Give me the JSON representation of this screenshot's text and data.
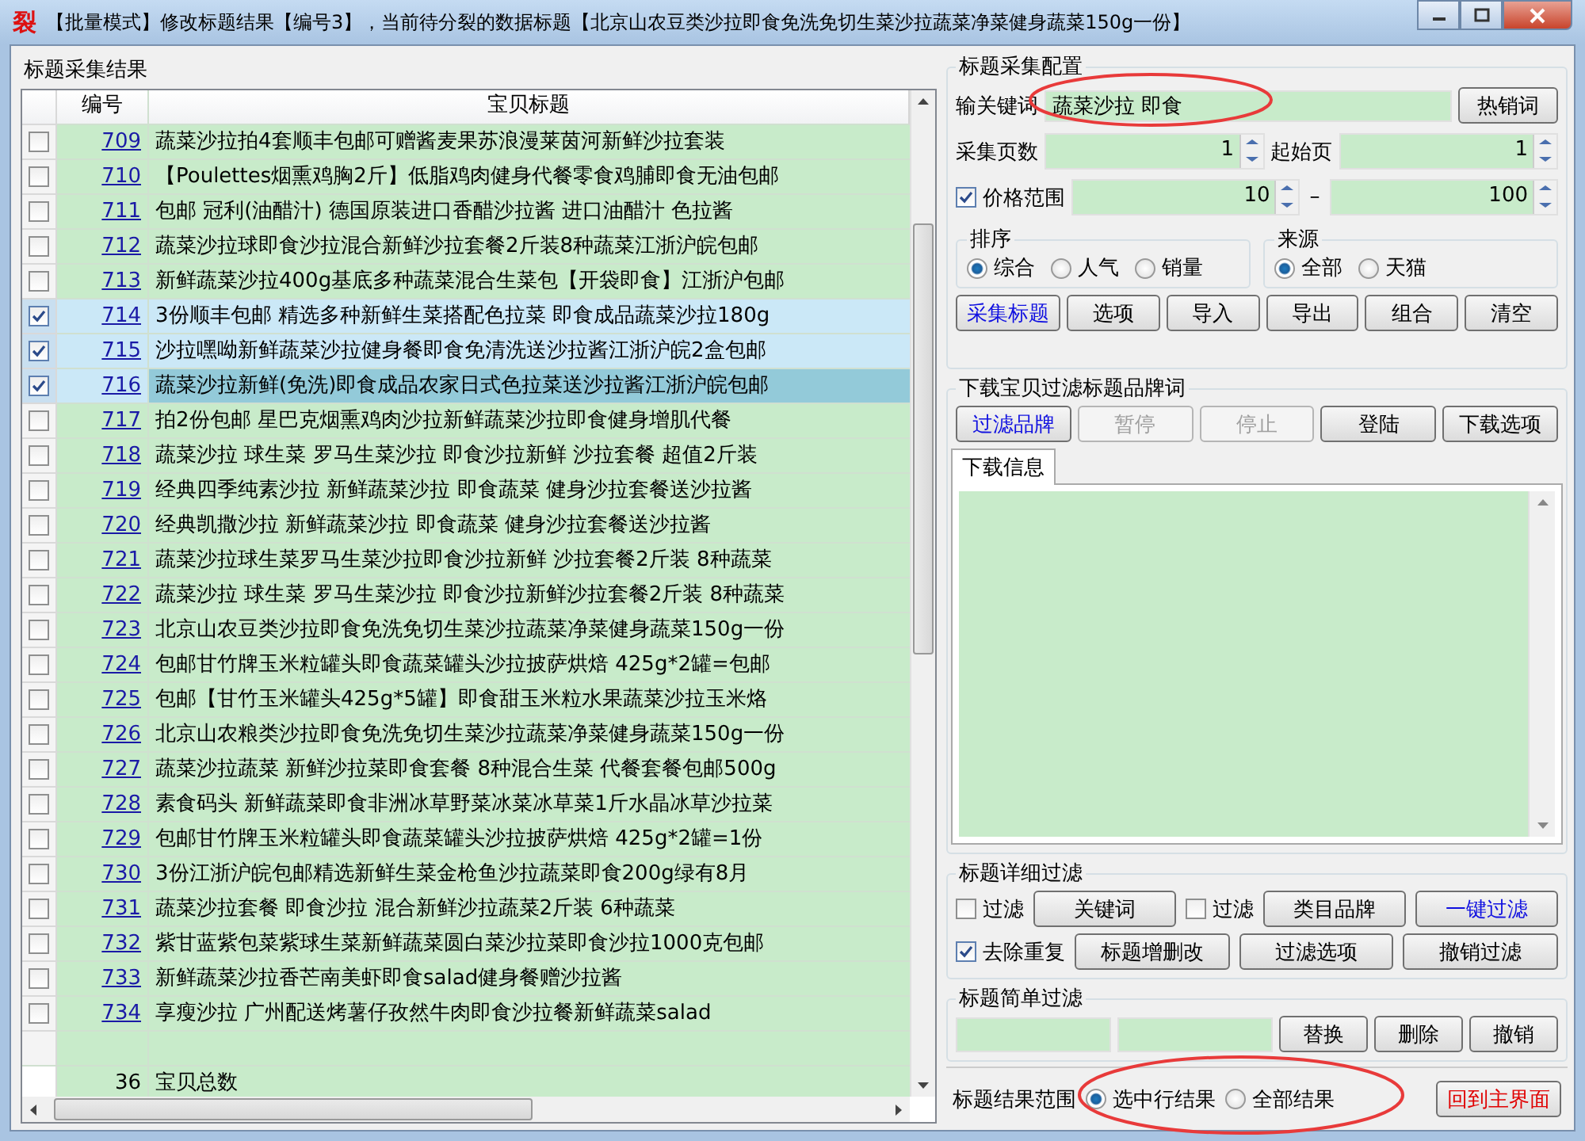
{
  "window": {
    "icon_text": "裂",
    "title": "【批量模式】修改标题结果【编号3】，当前待分裂的数据标题【北京山农豆类沙拉即食免洗免切生菜沙拉蔬菜净菜健身蔬菜150g一份】"
  },
  "results": {
    "title": "标题采集结果",
    "columns": [
      "编号",
      "宝贝标题"
    ],
    "rows": [
      {
        "number": "709",
        "title": "蔬菜沙拉拍4套顺丰包邮可赠酱麦果苏浪漫莱茵河新鲜沙拉套装",
        "checked": false,
        "selected": false
      },
      {
        "number": "710",
        "title": "【Poulettes烟熏鸡胸2斤】低脂鸡肉健身代餐零食鸡脯即食无油包邮",
        "checked": false,
        "selected": false
      },
      {
        "number": "711",
        "title": "包邮 冠利(油醋汁) 德国原装进口香醋沙拉酱 进口油醋汁 色拉酱",
        "checked": false,
        "selected": false
      },
      {
        "number": "712",
        "title": "蔬菜沙拉球即食沙拉混合新鲜沙拉套餐2斤装8种蔬菜江浙沪皖包邮",
        "checked": false,
        "selected": false
      },
      {
        "number": "713",
        "title": "新鲜蔬菜沙拉400g基底多种蔬菜混合生菜包【开袋即食】江浙沪包邮",
        "checked": false,
        "selected": false
      },
      {
        "number": "714",
        "title": "3份顺丰包邮 精选多种新鲜生菜搭配色拉菜 即食成品蔬菜沙拉180g",
        "checked": true,
        "selected": false
      },
      {
        "number": "715",
        "title": "沙拉嘿呦新鲜蔬菜沙拉健身餐即食免清洗送沙拉酱江浙沪皖2盒包邮",
        "checked": true,
        "selected": false
      },
      {
        "number": "716",
        "title": "蔬菜沙拉新鲜(免洗)即食成品农家日式色拉菜送沙拉酱江浙沪皖包邮",
        "checked": true,
        "selected": true
      },
      {
        "number": "717",
        "title": "拍2份包邮 星巴克烟熏鸡肉沙拉新鲜蔬菜沙拉即食健身增肌代餐",
        "checked": false,
        "selected": false
      },
      {
        "number": "718",
        "title": "蔬菜沙拉 球生菜 罗马生菜沙拉 即食沙拉新鲜 沙拉套餐 超值2斤装",
        "checked": false,
        "selected": false
      },
      {
        "number": "719",
        "title": "经典四季纯素沙拉 新鲜蔬菜沙拉 即食蔬菜 健身沙拉套餐送沙拉酱",
        "checked": false,
        "selected": false
      },
      {
        "number": "720",
        "title": "经典凯撒沙拉 新鲜蔬菜沙拉 即食蔬菜 健身沙拉套餐送沙拉酱",
        "checked": false,
        "selected": false
      },
      {
        "number": "721",
        "title": "蔬菜沙拉球生菜罗马生菜沙拉即食沙拉新鲜 沙拉套餐2斤装 8种蔬菜",
        "checked": false,
        "selected": false
      },
      {
        "number": "722",
        "title": "蔬菜沙拉 球生菜 罗马生菜沙拉 即食沙拉新鲜沙拉套餐2斤装 8种蔬菜",
        "checked": false,
        "selected": false
      },
      {
        "number": "723",
        "title": "北京山农豆类沙拉即食免洗免切生菜沙拉蔬菜净菜健身蔬菜150g一份",
        "checked": false,
        "selected": false
      },
      {
        "number": "724",
        "title": "包邮甘竹牌玉米粒罐头即食蔬菜罐头沙拉披萨烘焙 425g*2罐=包邮",
        "checked": false,
        "selected": false
      },
      {
        "number": "725",
        "title": "包邮【甘竹玉米罐头425g*5罐】即食甜玉米粒水果蔬菜沙拉玉米烙",
        "checked": false,
        "selected": false
      },
      {
        "number": "726",
        "title": "北京山农粮类沙拉即食免洗免切生菜沙拉蔬菜净菜健身蔬菜150g一份",
        "checked": false,
        "selected": false
      },
      {
        "number": "727",
        "title": "蔬菜沙拉蔬菜 新鲜沙拉菜即食套餐 8种混合生菜 代餐套餐包邮500g",
        "checked": false,
        "selected": false
      },
      {
        "number": "728",
        "title": "素食码头 新鲜蔬菜即食非洲冰草野菜冰菜冰草菜1斤水晶冰草沙拉菜",
        "checked": false,
        "selected": false
      },
      {
        "number": "729",
        "title": "包邮甘竹牌玉米粒罐头即食蔬菜罐头沙拉披萨烘焙 425g*2罐=1份",
        "checked": false,
        "selected": false
      },
      {
        "number": "730",
        "title": "3份江浙沪皖包邮精选新鲜生菜金枪鱼沙拉蔬菜即食200g绿有8月",
        "checked": false,
        "selected": false
      },
      {
        "number": "731",
        "title": "蔬菜沙拉套餐 即食沙拉 混合新鲜沙拉蔬菜2斤装 6种蔬菜",
        "checked": false,
        "selected": false
      },
      {
        "number": "732",
        "title": "紫甘蓝紫包菜紫球生菜新鲜蔬菜圆白菜沙拉菜即食沙拉1000克包邮",
        "checked": false,
        "selected": false
      },
      {
        "number": "733",
        "title": "新鲜蔬菜沙拉香芒南美虾即食salad健身餐赠沙拉酱",
        "checked": false,
        "selected": false
      },
      {
        "number": "734",
        "title": "享瘦沙拉 广州配送烤薯仔孜然牛肉即食沙拉餐新鲜蔬菜salad",
        "checked": false,
        "selected": false
      }
    ],
    "total_count": "36",
    "total_label": "宝贝总数"
  },
  "collect_config": {
    "title": "标题采集配置",
    "keyword_label": "输关键词",
    "keyword_value": "蔬菜沙拉 即食",
    "hot_button": "热销词",
    "pages_label": "采集页数",
    "pages_value": "1",
    "start_label": "起始页",
    "start_value": "1",
    "price_label": "价格范围",
    "price_checked": true,
    "price_min": "10",
    "price_separator": "–",
    "price_max": "100",
    "sort": {
      "title": "排序",
      "options": [
        {
          "label": "综合",
          "selected": true
        },
        {
          "label": "人气",
          "selected": false
        },
        {
          "label": "销量",
          "selected": false
        }
      ]
    },
    "source": {
      "title": "来源",
      "options": [
        {
          "label": "全部",
          "selected": true
        },
        {
          "label": "天猫",
          "selected": false
        }
      ]
    },
    "buttons": [
      {
        "label": "采集标题",
        "kind": "accent",
        "disabled": false
      },
      {
        "label": "选项",
        "kind": "normal",
        "disabled": false
      },
      {
        "label": "导入",
        "kind": "normal",
        "disabled": false
      },
      {
        "label": "导出",
        "kind": "normal",
        "disabled": false
      },
      {
        "label": "组合",
        "kind": "normal",
        "disabled": false
      },
      {
        "label": "清空",
        "kind": "normal",
        "disabled": false
      }
    ]
  },
  "download": {
    "title": "下载宝贝过滤标题品牌词",
    "buttons": [
      {
        "label": "过滤品牌",
        "kind": "accent",
        "disabled": false
      },
      {
        "label": "暂停",
        "kind": "normal",
        "disabled": true
      },
      {
        "label": "停止",
        "kind": "normal",
        "disabled": true
      },
      {
        "label": "登陆",
        "kind": "normal",
        "disabled": false
      },
      {
        "label": "下载选项",
        "kind": "normal",
        "disabled": false
      }
    ],
    "tab": "下载信息"
  },
  "detail_filter": {
    "title": "标题详细过滤",
    "row_1": [
      {
        "kind": "checkbox",
        "label": "过滤",
        "checked": false
      },
      {
        "kind": "button",
        "label": "关键词",
        "accent": false
      },
      {
        "kind": "checkbox",
        "label": "过滤",
        "checked": false
      },
      {
        "kind": "button",
        "label": "类目品牌",
        "accent": false
      },
      {
        "kind": "button",
        "label": "一键过滤",
        "accent": true
      }
    ],
    "row_2": [
      {
        "kind": "checkbox",
        "label": "去除重复",
        "checked": true
      },
      {
        "kind": "button",
        "label": "标题增删改",
        "accent": false
      },
      {
        "kind": "button",
        "label": "过滤选项",
        "accent": false
      },
      {
        "kind": "button",
        "label": "撤销过滤",
        "accent": false
      }
    ]
  },
  "simple_filter": {
    "title": "标题简单过滤",
    "buttons": [
      "替换",
      "删除",
      "撤销"
    ]
  },
  "result_scope": {
    "label": "标题结果范围",
    "options": [
      {
        "label": "选中行结果",
        "selected": true
      },
      {
        "label": "全部结果",
        "selected": false
      }
    ],
    "back_button": "回到主界面"
  }
}
